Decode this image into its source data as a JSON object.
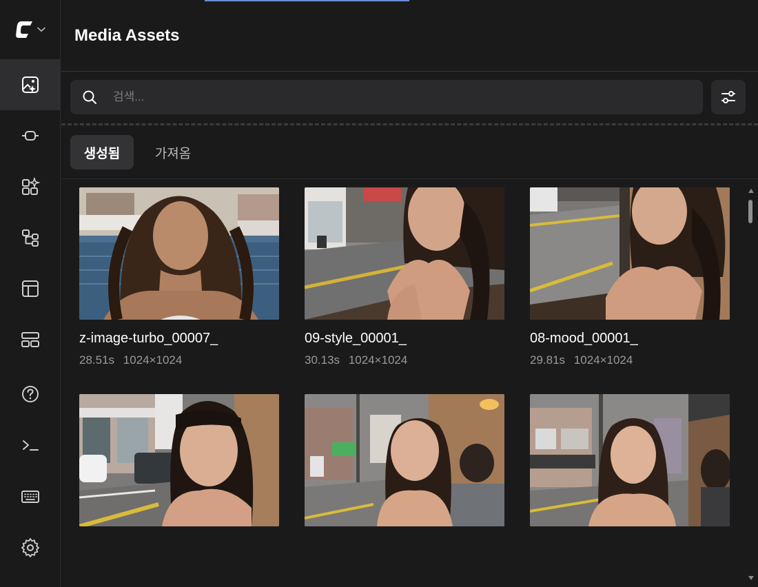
{
  "app": {
    "title": "Media Assets"
  },
  "colors": {
    "background": "#1a1a1b",
    "rail_active": "#2e2e30",
    "input_background": "#2a2a2c",
    "accent_line": "#6b8bd6",
    "muted_text": "#9a9a9d"
  },
  "sidebar": {
    "logo_icon": "comfy-logo-icon",
    "items": [
      {
        "icon": "media-assets-icon",
        "active": true
      },
      {
        "icon": "node-link-icon",
        "active": false
      },
      {
        "icon": "node-library-icon",
        "active": false
      },
      {
        "icon": "workflow-icon",
        "active": false
      },
      {
        "icon": "templates-icon",
        "active": false
      },
      {
        "icon": "layout-icon",
        "active": false
      },
      {
        "icon": "help-icon",
        "active": false
      },
      {
        "icon": "terminal-icon",
        "active": false
      },
      {
        "icon": "keyboard-icon",
        "active": false
      },
      {
        "icon": "settings-icon",
        "active": false
      }
    ]
  },
  "search": {
    "placeholder": "검색...",
    "value": ""
  },
  "tabs": [
    {
      "label": "생성됨",
      "active": true
    },
    {
      "label": "가져옴",
      "active": false
    }
  ],
  "assets": [
    {
      "name": "z-image-turbo_00007_",
      "duration": "28.51s",
      "dimensions": "1024×1024"
    },
    {
      "name": "09-style_00001_",
      "duration": "30.13s",
      "dimensions": "1024×1024"
    },
    {
      "name": "08-mood_00001_",
      "duration": "29.81s",
      "dimensions": "1024×1024"
    },
    {
      "name": "",
      "duration": "",
      "dimensions": ""
    },
    {
      "name": "",
      "duration": "",
      "dimensions": ""
    },
    {
      "name": "",
      "duration": "",
      "dimensions": ""
    }
  ],
  "scrollbar": {
    "position": 0.05
  }
}
